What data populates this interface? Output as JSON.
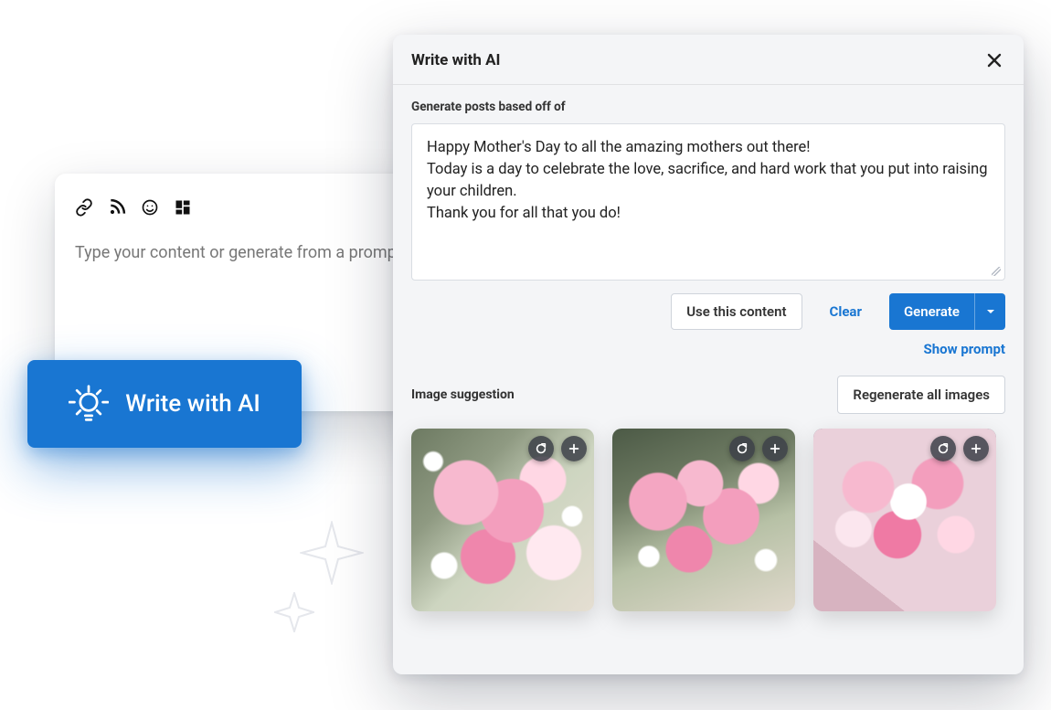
{
  "compose": {
    "placeholder": "Type your content or generate from a prompt..."
  },
  "write_ai_button": {
    "label": "Write with AI"
  },
  "panel": {
    "title": "Write with AI",
    "section_label": "Generate posts based off of",
    "prompt_line1": "Happy Mother's Day to all the amazing mothers out there!",
    "prompt_line2": "Today is a day to celebrate the love, sacrifice, and hard work that you put into raising your children.",
    "prompt_line3": "Thank you for all that you do!",
    "use_content_label": "Use this content",
    "clear_label": "Clear",
    "generate_label": "Generate",
    "show_prompt_label": "Show prompt",
    "image_suggestion_label": "Image suggestion",
    "regenerate_all_label": "Regenerate all images"
  },
  "colors": {
    "primary": "#1976d2"
  }
}
